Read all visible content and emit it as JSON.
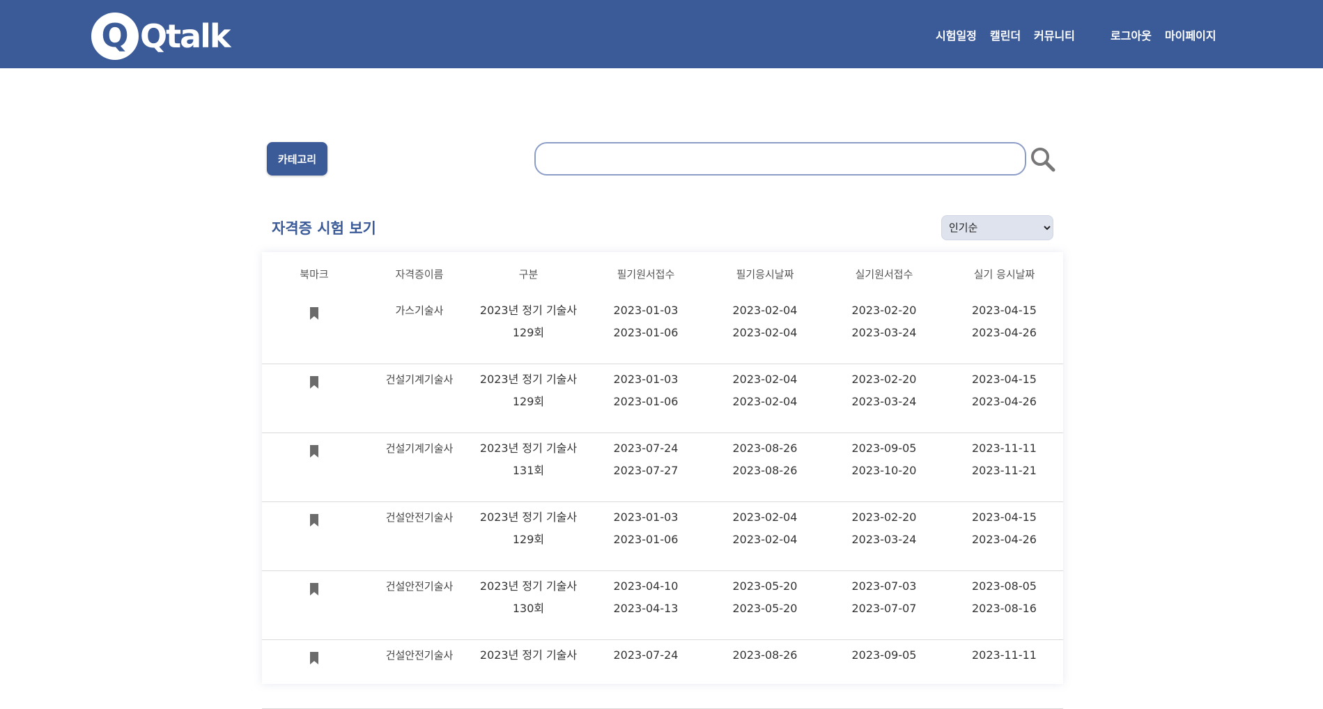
{
  "header": {
    "logo_text": "Qtalk",
    "nav": {
      "schedule": "시험일정",
      "calendar": "캘린더",
      "community": "커뮤니티",
      "logout": "로그아웃",
      "mypage": "마이페이지"
    }
  },
  "toolbar": {
    "category_label": "카테고리",
    "search_placeholder": ""
  },
  "section": {
    "title": "자격증 시험 보기",
    "sort_selected": "인기순"
  },
  "table": {
    "headers": [
      "북마크",
      "자격증이름",
      "구분",
      "필기원서접수",
      "필기응시날짜",
      "실기원서접수",
      "실기 응시날짜"
    ],
    "rows": [
      {
        "name": "가스기술사",
        "type": "2023년 정기 기술사",
        "round": "129회",
        "w_apply_start": "2023-01-03",
        "w_apply_end": "2023-01-06",
        "w_exam_start": "2023-02-04",
        "w_exam_end": "2023-02-04",
        "p_apply_start": "2023-02-20",
        "p_apply_end": "2023-03-24",
        "p_exam_start": "2023-04-15",
        "p_exam_end": "2023-04-26"
      },
      {
        "name": "건설기계기술사",
        "type": "2023년 정기 기술사",
        "round": "129회",
        "w_apply_start": "2023-01-03",
        "w_apply_end": "2023-01-06",
        "w_exam_start": "2023-02-04",
        "w_exam_end": "2023-02-04",
        "p_apply_start": "2023-02-20",
        "p_apply_end": "2023-03-24",
        "p_exam_start": "2023-04-15",
        "p_exam_end": "2023-04-26"
      },
      {
        "name": "건설기계기술사",
        "type": "2023년 정기 기술사",
        "round": "131회",
        "w_apply_start": "2023-07-24",
        "w_apply_end": "2023-07-27",
        "w_exam_start": "2023-08-26",
        "w_exam_end": "2023-08-26",
        "p_apply_start": "2023-09-05",
        "p_apply_end": "2023-10-20",
        "p_exam_start": "2023-11-11",
        "p_exam_end": "2023-11-21"
      },
      {
        "name": "건설안전기술사",
        "type": "2023년 정기 기술사",
        "round": "129회",
        "w_apply_start": "2023-01-03",
        "w_apply_end": "2023-01-06",
        "w_exam_start": "2023-02-04",
        "w_exam_end": "2023-02-04",
        "p_apply_start": "2023-02-20",
        "p_apply_end": "2023-03-24",
        "p_exam_start": "2023-04-15",
        "p_exam_end": "2023-04-26"
      },
      {
        "name": "건설안전기술사",
        "type": "2023년 정기 기술사",
        "round": "130회",
        "w_apply_start": "2023-04-10",
        "w_apply_end": "2023-04-13",
        "w_exam_start": "2023-05-20",
        "w_exam_end": "2023-05-20",
        "p_apply_start": "2023-07-03",
        "p_apply_end": "2023-07-07",
        "p_exam_start": "2023-08-05",
        "p_exam_end": "2023-08-16"
      },
      {
        "name": "건설안전기술사",
        "type": "2023년 정기 기술사",
        "round": "",
        "w_apply_start": "2023-07-24",
        "w_apply_end": "",
        "w_exam_start": "2023-08-26",
        "w_exam_end": "",
        "p_apply_start": "2023-09-05",
        "p_apply_end": "",
        "p_exam_start": "2023-11-11",
        "p_exam_end": ""
      }
    ]
  },
  "colors": {
    "brand": "#3b5a98",
    "bookmark": "#6b6b6b",
    "search_icon": "#777777"
  },
  "icons": {
    "search": "search-icon",
    "bookmark": "bookmark-icon"
  }
}
